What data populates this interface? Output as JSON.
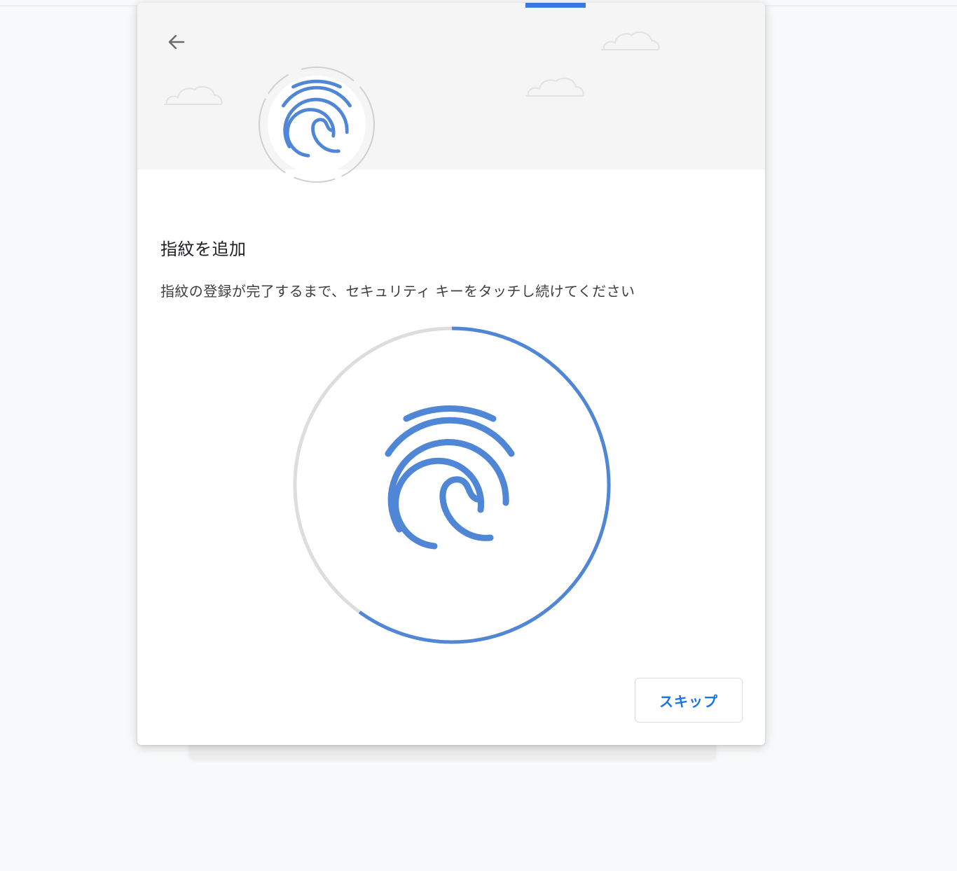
{
  "dialog": {
    "title": "指紋を追加",
    "description": "指紋の登録が完了するまで、セキュリティ キーをタッチし続けてください",
    "skip_label": "スキップ",
    "back_icon": "arrow-left-icon",
    "header_icon": "fingerprint-icon",
    "main_icon": "fingerprint-icon"
  },
  "enrollment": {
    "progress_fraction": 0.6
  },
  "colors": {
    "accent": "#1a73e8",
    "fingerprint": "#4f86d6",
    "ring_track": "#dddddd",
    "header_bg": "#f5f5f5"
  }
}
